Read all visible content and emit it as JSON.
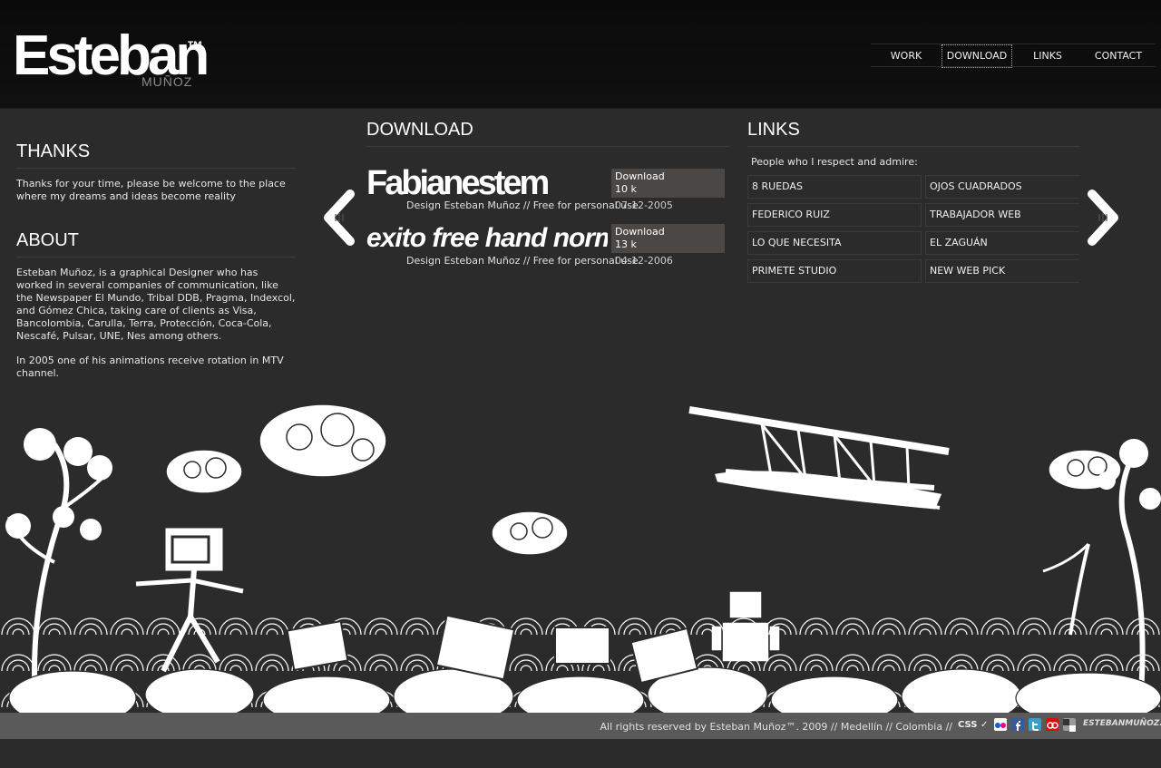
{
  "logo": {
    "name": "Esteban",
    "tm": "™",
    "surname": "MUÑOZ"
  },
  "nav": {
    "items": [
      "WORK",
      "DOWNLOAD",
      "LINKS",
      "CONTACT"
    ],
    "active": "DOWNLOAD"
  },
  "thanks": {
    "title": "THANKS",
    "text": "Thanks for your time, please be welcome to the place where my dreams and ideas become reality"
  },
  "about": {
    "title": "ABOUT",
    "paragraph1": "Esteban Muñoz, is a graphical Designer who has worked in several companies of communication, like the Newspaper El Mundo, Tribal DDB, Pragma, Indexcol, and Gómez Chica, taking care of clients as Visa, Bancolombia, Carulla, Terra, Protección, Coca-Cola, Nescafé, Pulsar, UNE, Nes among others.",
    "paragraph2": "In 2005 one of his animations receive rotation in MTV channel."
  },
  "download": {
    "title": "DOWNLOAD",
    "fonts": [
      {
        "preview": "Fabianestem",
        "button_label": "Download",
        "size": "10 k",
        "meta": "Design Esteban Muñoz // Free for personal use",
        "date": "07-12-2005"
      },
      {
        "preview": "exito free hand normal",
        "button_label": "Download",
        "size": "13 k",
        "meta": "Design Esteban Muñoz // Free for personal use",
        "date": "04-12-2006"
      }
    ]
  },
  "links": {
    "title": "LINKS",
    "intro": "People who I respect and admire:",
    "items": [
      "8 RUEDAS",
      "OJOS CUADRADOS",
      "FEDERICO RUIZ",
      "TRABAJADOR WEB",
      "LO QUE NECESITA",
      "EL ZAGUÁN",
      "PRIMETE STUDIO",
      "NEW WEB PICK"
    ]
  },
  "footer": {
    "copyright": "All rights reserved by Esteban Muñoz™. 2009 // Medellín // Colombia //",
    "css_badge": "CSS",
    "credit": "ESTEBANMUÑOZ.COM"
  },
  "colors": {
    "header_bg": "#0a0a0a",
    "page_bg": "#2b2b2b",
    "footer_bg": "#5a5a5a",
    "download_box": "#4a4745",
    "flickr_blue": "#0063dc",
    "facebook_blue": "#3b5998",
    "twitter_blue": "#33a1c9",
    "lastfm_red": "#d51007",
    "delicious_gray": "#9a9a9a"
  },
  "icons": [
    "arrow-left-icon",
    "arrow-right-icon",
    "css-check-icon",
    "flickr-icon",
    "facebook-icon",
    "twitter-icon",
    "lastfm-icon",
    "delicious-icon"
  ]
}
